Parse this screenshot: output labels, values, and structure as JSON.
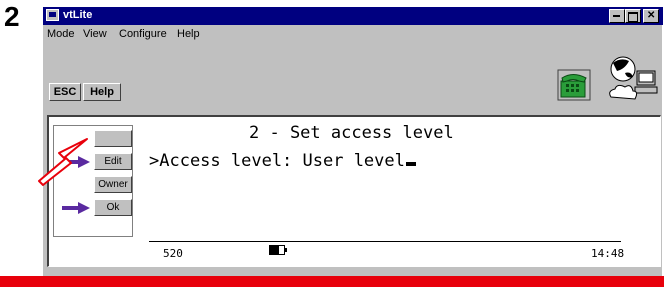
{
  "step": "2",
  "window": {
    "title": "vtLite"
  },
  "menu": [
    "Mode",
    "View",
    "Configure",
    "Help"
  ],
  "toolbar": {
    "esc_label": "ESC",
    "help_label": "Help"
  },
  "screen": {
    "title": "2 - Set access level",
    "line": ">Access level: User level"
  },
  "softkeys": [
    {
      "label": "",
      "arrow": false
    },
    {
      "label": "Edit",
      "arrow": true
    },
    {
      "label": "Owner",
      "arrow": false
    },
    {
      "label": "Ok",
      "arrow": true
    }
  ],
  "status": {
    "left": "520",
    "time": "14:48"
  },
  "icons": {
    "phone": "phone-icon",
    "network": "network-icon",
    "softkey_arrow": "arrow-icon",
    "pointer": "pointer-arrow-icon",
    "battery": "battery-icon"
  },
  "colors": {
    "titlebar": "#000080",
    "arrow": "#5a2aa0",
    "pointer_outline": "#e8000b",
    "bottom_bar": "#e8000b",
    "phone": "#2a9d3a"
  }
}
